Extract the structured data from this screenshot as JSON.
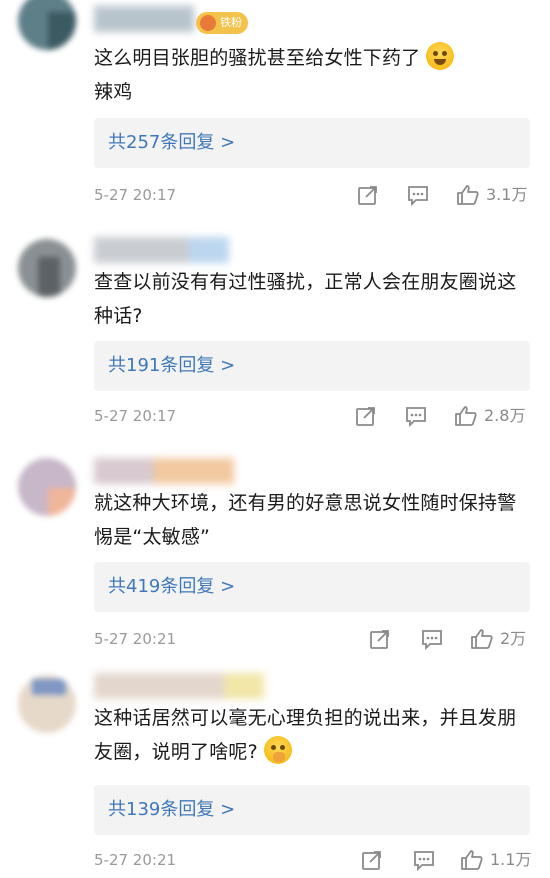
{
  "comments": [
    {
      "name_partial": "toucima",
      "badge": "铁粉",
      "text": "这么明目张胆的骚扰甚至给女性下药了",
      "text_line2": "辣鸡",
      "emoji": "weary-face",
      "reply_label": "共257条回复 >",
      "time": "5-27 20:17",
      "likes": "3.1万"
    },
    {
      "text": "查查以前没有有过性骚扰，正常人会在朋友圈说这种话?",
      "reply_label": "共191条回复 >",
      "time": "5-27 20:17",
      "likes": "2.8万"
    },
    {
      "text": "就这种大环境，还有男的好意思说女性随时保持警惕是“太敏感”",
      "reply_label": "共419条回复 >",
      "time": "5-27 20:21",
      "likes": "2万"
    },
    {
      "text": "这种话居然可以毫无心理负担的说出来，并且发朋友圈，说明了啥呢?",
      "emoji": "shushing-face",
      "reply_label": "共139条回复 >",
      "time": "5-27 20:21",
      "likes": "1.1万"
    }
  ],
  "icons": [
    "repost-icon",
    "comment-icon",
    "thumbs-up-icon"
  ],
  "colors": {
    "link": "#3f78b8",
    "reply_bg": "#f3f3f3",
    "meta": "#9a9a9a",
    "badge": "#f2c24a"
  }
}
